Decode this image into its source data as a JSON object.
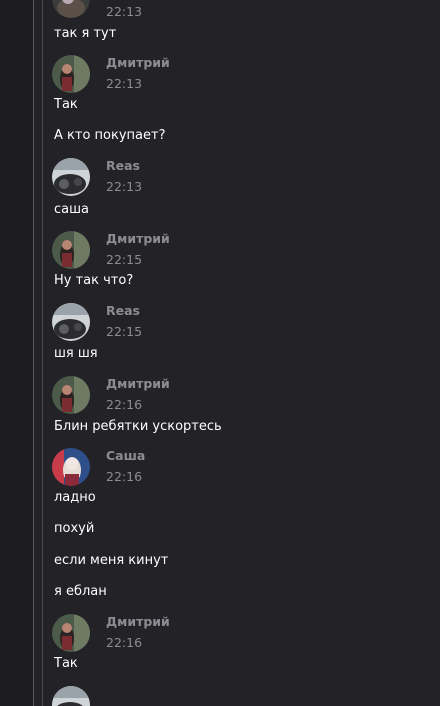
{
  "colors": {
    "background": "#222227",
    "text": "#ffffff",
    "meta": "#8c8c92"
  },
  "messages": [
    {
      "time": "22:13"
    },
    {
      "text": "так я тут"
    },
    {
      "author": "Дмитрий",
      "time": "22:13"
    },
    {
      "text": "Так"
    },
    {
      "text": "А кто покупает?"
    },
    {
      "author": "Reas",
      "time": "22:13"
    },
    {
      "text": "саша"
    },
    {
      "author": "Дмитрий",
      "time": "22:15"
    },
    {
      "text": "Ну так что?"
    },
    {
      "author": "Reas",
      "time": "22:15"
    },
    {
      "text": "шя шя"
    },
    {
      "author": "Дмитрий",
      "time": "22:16"
    },
    {
      "text": "Блин ребятки ускортесь"
    },
    {
      "author": "Саша",
      "time": "22:16"
    },
    {
      "text": "ладно"
    },
    {
      "text": "похуй"
    },
    {
      "text": "если меня кинут"
    },
    {
      "text": "я еблан"
    },
    {
      "author": "Дмитрий",
      "time": "22:16"
    },
    {
      "text": "Так"
    }
  ]
}
